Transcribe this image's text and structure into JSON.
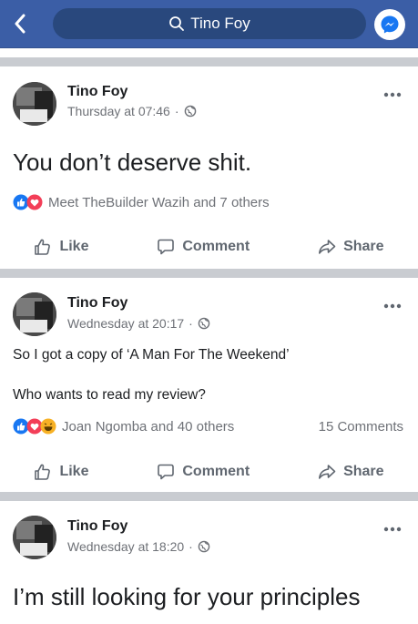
{
  "header": {
    "search_text": "Tino Foy",
    "icons": [
      "back-arrow-icon",
      "search-icon",
      "messenger-icon"
    ]
  },
  "posts": [
    {
      "author": "Tino Foy",
      "timestamp": "Thursday at 07:46",
      "privacy": "public-globe-icon",
      "text": "You don’t deserve shit.",
      "reactions_text": "Meet TheBuilder Wazih and 7 others",
      "comments_text": "",
      "actions": {
        "like": "Like",
        "comment": "Comment",
        "share": "Share"
      }
    },
    {
      "author": "Tino Foy",
      "timestamp": "Wednesday at 20:17",
      "privacy": "public-globe-icon",
      "text_line1": "So I got a copy of ‘A Man For The Weekend’",
      "text_line2": "Who wants to read my review?",
      "reactions_text": "Joan Ngomba and 40 others",
      "comments_text": "15 Comments",
      "actions": {
        "like": "Like",
        "comment": "Comment",
        "share": "Share"
      }
    },
    {
      "author": "Tino Foy",
      "timestamp": "Wednesday at 18:20",
      "privacy": "public-globe-icon",
      "text": "I’m still looking for your principles"
    }
  ],
  "colors": {
    "header_bg": "#3b5ea6",
    "search_bg": "#29487d",
    "like_blue": "#1877f2",
    "love_red": "#f33e58",
    "haha_yellow": "#f7b125",
    "separator": "#c9ccd1"
  }
}
